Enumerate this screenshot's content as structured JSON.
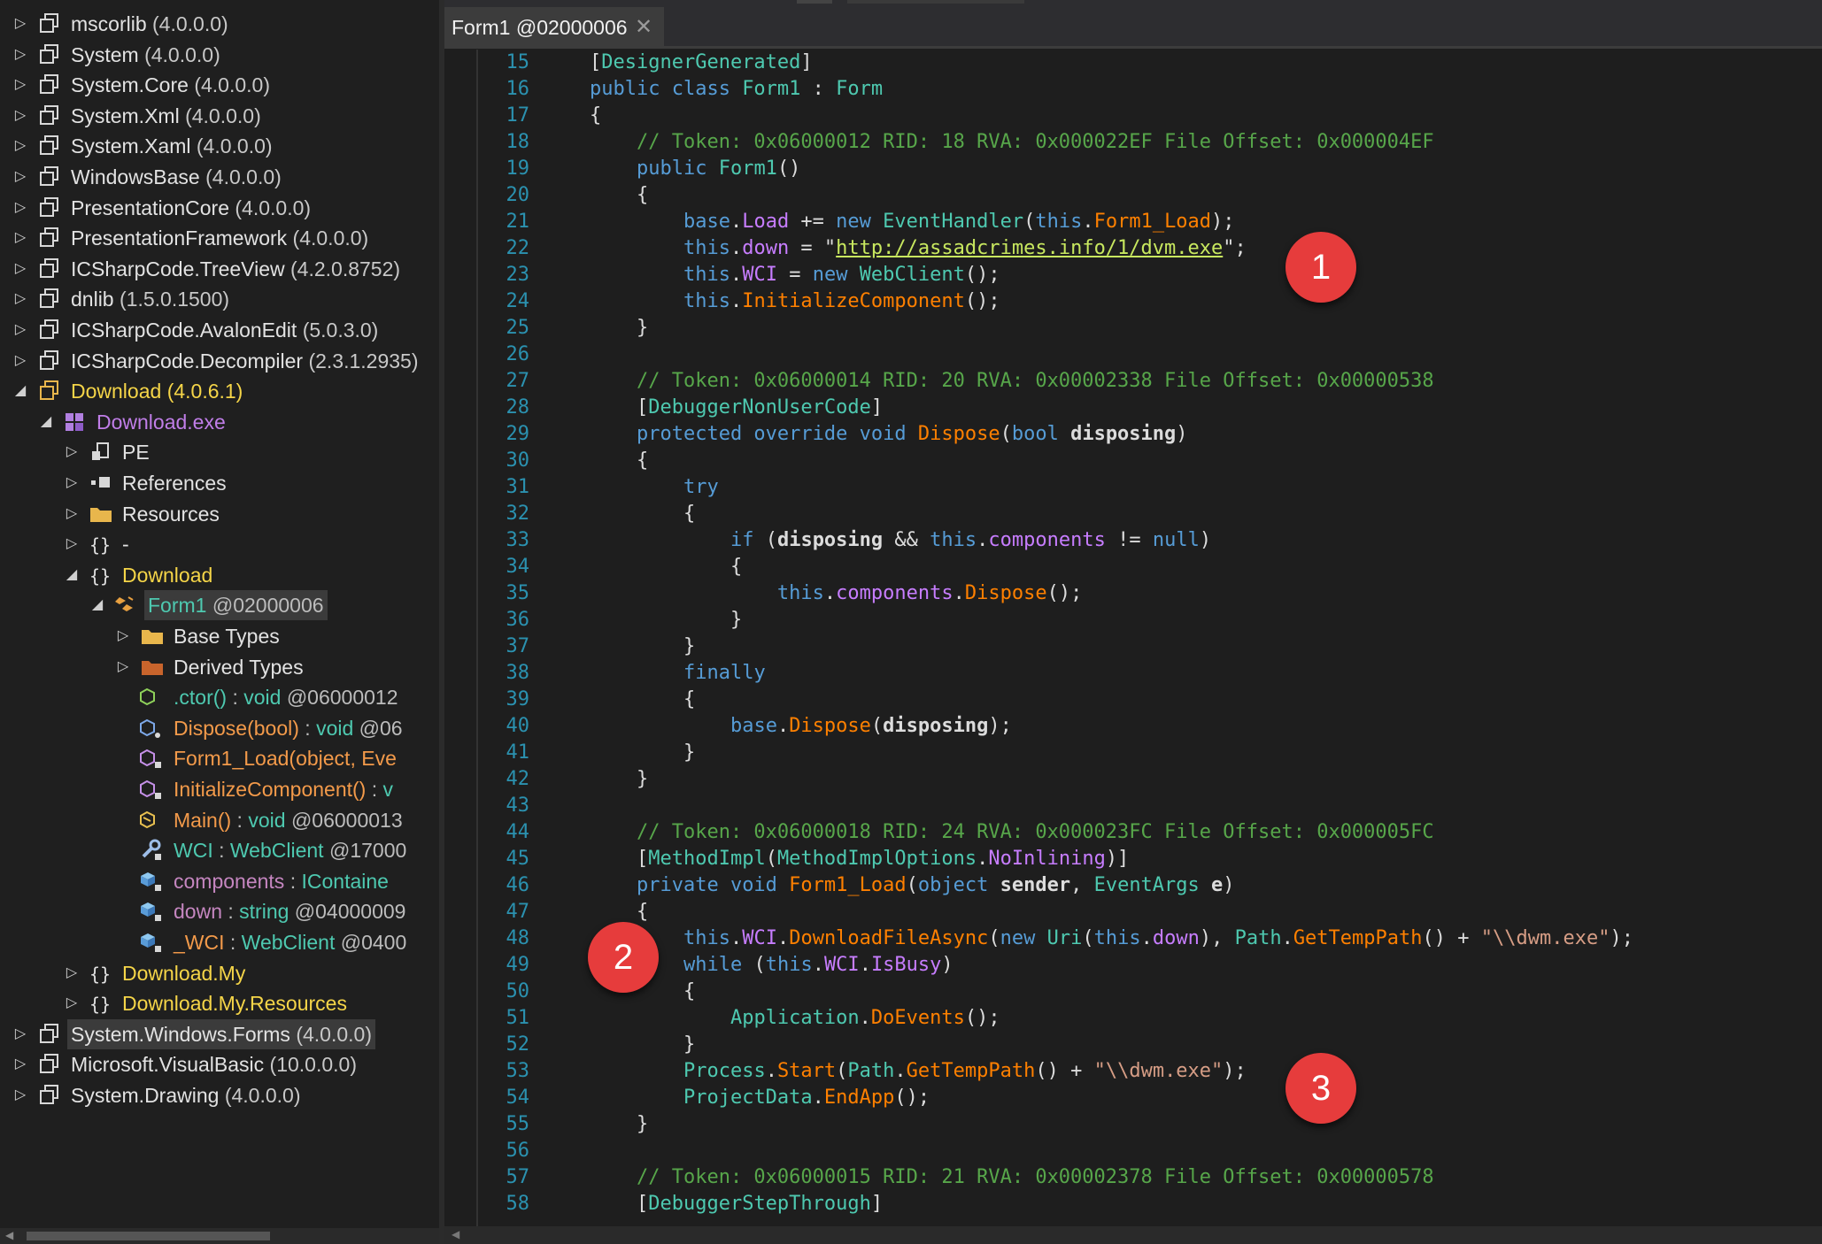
{
  "tree": {
    "items": [
      {
        "name": "mscorlib",
        "version": "(4.0.0.0)"
      },
      {
        "name": "System",
        "version": "(4.0.0.0)"
      },
      {
        "name": "System.Core",
        "version": "(4.0.0.0)"
      },
      {
        "name": "System.Xml",
        "version": "(4.0.0.0)"
      },
      {
        "name": "System.Xaml",
        "version": "(4.0.0.0)"
      },
      {
        "name": "WindowsBase",
        "version": "(4.0.0.0)"
      },
      {
        "name": "PresentationCore",
        "version": "(4.0.0.0)"
      },
      {
        "name": "PresentationFramework",
        "version": "(4.0.0.0)"
      },
      {
        "name": "ICSharpCode.TreeView",
        "version": "(4.2.0.8752)"
      },
      {
        "name": "dnlib",
        "version": "(1.5.0.1500)"
      },
      {
        "name": "ICSharpCode.AvalonEdit",
        "version": "(5.0.3.0)"
      },
      {
        "name": "ICSharpCode.Decompiler",
        "version": "(2.3.1.2935)"
      },
      {
        "name": "Download",
        "version": "(4.0.6.1)"
      },
      {
        "name": "Download.exe"
      },
      {
        "name": "PE"
      },
      {
        "name": "References"
      },
      {
        "name": "Resources"
      },
      {
        "name": "-"
      },
      {
        "name": "Download"
      },
      {
        "name": "Form1",
        "version": "@02000006"
      },
      {
        "name": "Base Types"
      },
      {
        "name": "Derived Types"
      },
      {
        "name": ".ctor()",
        "sep": " : ",
        "type": "void",
        "token": "@06000012"
      },
      {
        "name": "Dispose(bool)",
        "sep": " : ",
        "type": "void",
        "token": "@06"
      },
      {
        "name": "Form1_Load(object, Eve",
        "sep": "",
        "type": "",
        "token": ""
      },
      {
        "name": "InitializeComponent()",
        "sep": " : ",
        "type": "v",
        "token": ""
      },
      {
        "name": "Main()",
        "sep": " : ",
        "type": "void",
        "token": "@06000013"
      },
      {
        "name": "WCI",
        "sep": " : ",
        "type": "WebClient",
        "token": "@17000"
      },
      {
        "name": "components",
        "sep": " : ",
        "type": "IContaine",
        "token": ""
      },
      {
        "name": "down",
        "sep": " : ",
        "type": "string",
        "token": "@04000009"
      },
      {
        "name": "_WCI",
        "sep": " : ",
        "type": "WebClient",
        "token": "@0400"
      },
      {
        "name": "Download.My"
      },
      {
        "name": "Download.My.Resources"
      },
      {
        "name": "System.Windows.Forms",
        "version": "(4.0.0.0)"
      },
      {
        "name": "Microsoft.VisualBasic",
        "version": "(10.0.0.0)"
      },
      {
        "name": "System.Drawing",
        "version": "(4.0.0.0)"
      }
    ]
  },
  "tab": {
    "title": "Form1 @02000006",
    "close": "✕"
  },
  "code": {
    "line_numbers": [
      "15",
      "16",
      "17",
      "18",
      "19",
      "20",
      "21",
      "22",
      "23",
      "24",
      "25",
      "26",
      "27",
      "28",
      "29",
      "30",
      "31",
      "32",
      "33",
      "34",
      "35",
      "36",
      "37",
      "38",
      "39",
      "40",
      "41",
      "42",
      "43",
      "44",
      "45",
      "46",
      "47",
      "48",
      "49",
      "50",
      "51",
      "52",
      "53",
      "54",
      "55",
      "56",
      "57",
      "58"
    ],
    "tokens": {
      "designer_generated": "DesignerGenerated",
      "form1": "Form1",
      "form": "Form",
      "comment_18": "// Token: 0x06000012 RID: 18 RVA: 0x000022EF File Offset: 0x000004EF",
      "form1_load": "Form1_Load",
      "event_handler": "EventHandler",
      "down": "down",
      "url": "http://assadcrimes.info/1/dvm.exe",
      "wci": "WCI",
      "webclient": "WebClient",
      "initialize_component": "InitializeComponent",
      "comment_27": "// Token: 0x06000014 RID: 20 RVA: 0x00002338 File Offset: 0x00000538",
      "debugger_non_user_code": "DebuggerNonUserCode",
      "dispose": "Dispose",
      "disposing": "disposing",
      "components": "components",
      "comment_44": "// Token: 0x06000018 RID: 24 RVA: 0x000023FC File Offset: 0x000005FC",
      "method_impl": "MethodImpl",
      "method_impl_options": "MethodImplOptions",
      "no_inlining": "NoInlining",
      "event_args": "EventArgs",
      "sender": "sender",
      "e": "e",
      "download_file_async": "DownloadFileAsync",
      "uri": "Uri",
      "path": "Path",
      "get_temp_path": "GetTempPath",
      "dwm_exe": "\"\\\\dwm.exe\"",
      "is_busy": "IsBusy",
      "application": "Application",
      "do_events": "DoEvents",
      "process": "Process",
      "start": "Start",
      "project_data": "ProjectData",
      "end_app": "EndApp",
      "comment_57": "// Token: 0x06000015 RID: 21 RVA: 0x00002378 File Offset: 0x00000578",
      "debugger_step_through": "DebuggerStepThrough"
    }
  },
  "callouts": [
    "1",
    "2",
    "3"
  ],
  "colors": {
    "keyword": "#569cd6",
    "comment": "#57a64a",
    "type": "#4ec9b0",
    "method": "#ff8000",
    "field": "#c77dff",
    "string": "#d69d85",
    "url": "#c8e85f",
    "badge": "#e63c3c"
  }
}
